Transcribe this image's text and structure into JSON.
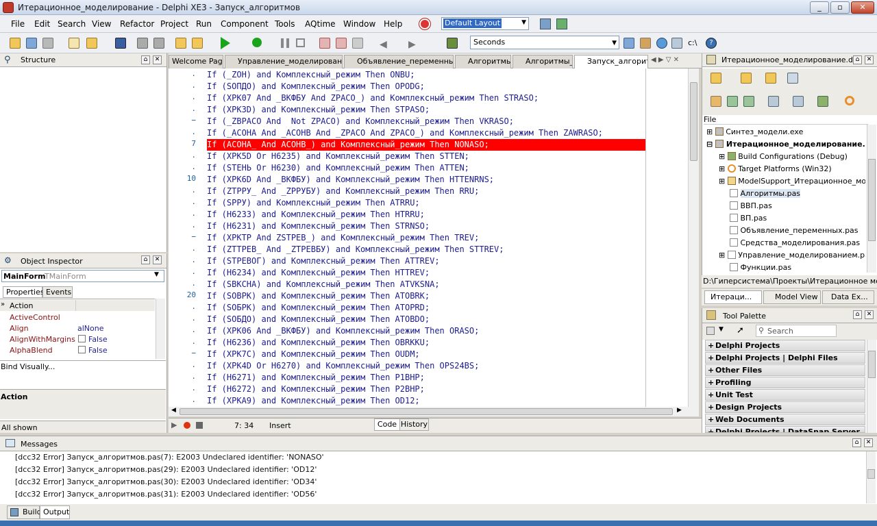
{
  "window": {
    "title": "Итерационное_моделирование - Delphi XE3 - Запуск_алгоритмов"
  },
  "menu": {
    "items": [
      "File",
      "Edit",
      "Search",
      "View",
      "Refactor",
      "Project",
      "Run",
      "Component",
      "Tools",
      "AQtime",
      "Window",
      "Help"
    ],
    "layout_value": "Default Layout"
  },
  "toolbar": {
    "time_unit": "Seconds"
  },
  "structure": {
    "title": "Structure"
  },
  "object_inspector": {
    "title": "Object Inspector",
    "component": "MainForm",
    "component_type": "TMainForm",
    "tabs": [
      "Properties",
      "Events"
    ],
    "properties": [
      {
        "name": "Action",
        "value": ""
      },
      {
        "name": "ActiveControl",
        "value": ""
      },
      {
        "name": "Align",
        "value": "alNone"
      },
      {
        "name": "AlignWithMargins",
        "value": "False"
      },
      {
        "name": "AlphaBlend",
        "value": "False"
      }
    ],
    "bind_visually": "Bind Visually...",
    "desc_title": "Action",
    "footer": "All shown"
  },
  "editor": {
    "tabs": [
      "Welcome Page",
      "Управление_моделирован",
      "Объявление_переменных",
      "Алгоритмы",
      "Алгоритмы_",
      "Запуск_алгоритм"
    ],
    "lines": [
      "If (_ZOH) and Комплексный_режим Then ONBU;",
      "If (SOПДО) and Комплексный_режим Then OPODG;",
      "If (XPK07 And _BKФБУ And ZPACO_) and Комплексный_режим Then STRASO;",
      "If (XPK3D) and Комплексный_режим Then STPASO;",
      "If (_ZBPACO And  Not ZPACO) and Комплексный_режим Then VKRASO;",
      "If (_ACOHA And _ACOHB And _ZPACO And ZPACO_) and Комплексный_режим Then ZAWRASO;",
      "If (ACOHA_ And ACOHB_) and Комплексный_режим Then NONASO;",
      "If (XPK5D Or H6235) and Комплексный_режим Then STTEN;",
      "If (STEHЬ Or H6230) and Комплексный_режим Then ATTEN;",
      "If (XPK6D And _BKФБУ) and Комплексный_режим Then HTTENRNS;",
      "If (ZTPPУ_ And _ZPPУБУ) and Комплексный_режим Then RRU;",
      "If (SPPУ) and Комплексный_режим Then ATRRU;",
      "If (H6233) and Комплексный_режим Then HTRRU;",
      "If (H6231) and Комплексный_режим Then STRNSO;",
      "If (XPKTP And ZSTPEB_) and Комплексный_режим Then TREV;",
      "If (ZTTPEB_ And _ZTPEBБУ) and Комплексный_режим Then STTREV;",
      "If (STPEBОГ) and Комплексный_режим Then ATTREV;",
      "If (H6234) and Комплексный_режим Then HTTREV;",
      "If (SBKCHA) and Комплексный_режим Then ATVKSNA;",
      "If (SOBPK) and Комплексный_режим Then ATOBRK;",
      "If (SOБPK) and Комплексный_режим Then ATOPRD;",
      "If (SOБДО) and Комплексный_режим Then ATOBDO;",
      "If (XPK06 And _BKФБУ) and Комплексный_режим Then ORASO;",
      "If (H6236) and Комплексный_режим Then OBRKKU;",
      "If (XPK7C) and Комплексный_режим Then OUDM;",
      "If (XPK4D Or H6270) and Комплексный_режим Then OPS24BS;",
      "If (H6271) and Комплексный_режим Then P1BHP;",
      "If (H6272) and Комплексный_режим Then P2BHP;",
      "If (XPKA9) and Комплексный_режим Then OD12;"
    ],
    "gutter": {
      "l0": ".",
      "l1": ".",
      "l2": ".",
      "l3": ".",
      "l4": "−",
      "l5": ".",
      "l6": "7",
      "l7": ".",
      "l8": ".",
      "l9": "10",
      "l10": ".",
      "l11": ".",
      "l12": ".",
      "l13": ".",
      "l14": "−",
      "l15": ".",
      "l16": ".",
      "l17": ".",
      "l18": ".",
      "l19": "20",
      "l20": ".",
      "l21": ".",
      "l22": ".",
      "l23": ".",
      "l24": "−",
      "l25": ".",
      "l26": ".",
      "l27": ".",
      "l28": "."
    },
    "error_line_index": 6,
    "status": {
      "position": "7: 34",
      "mode": "Insert",
      "tabs": [
        "Code",
        "History"
      ]
    }
  },
  "project": {
    "title": "Итерационное_моделирование.d...",
    "file_label": "File",
    "items": [
      "Синтез_модели.exe",
      "Итерационное_моделирование...",
      "Build Configurations (Debug)",
      "Target Platforms (Win32)",
      "ModelSupport_Итерационное_мо...",
      "Алгоритмы.pas",
      "ВВП.pas",
      "ВП.pas",
      "Объявление_переменных.pas",
      "Средства_моделирования.pas",
      "Управление_моделированием.pas",
      "Функции.pas"
    ],
    "path": "D:\\Гиперсистема\\Проекты\\Итерационное моделир",
    "view_tabs": [
      "Итераци...",
      "Model View",
      "Data Ex..."
    ]
  },
  "tool_palette": {
    "title": "Tool Palette",
    "search_placeholder": "Search",
    "categories": [
      "Delphi Projects",
      "Delphi Projects | Delphi Files",
      "Other Files",
      "Profiling",
      "Unit Test",
      "Design Projects",
      "Web Documents",
      "Delphi Projects | DataSnap Server"
    ]
  },
  "messages": {
    "title": "Messages",
    "lines": [
      "[dcc32 Error] Запуск_алгоритмов.pas(7): E2003 Undeclared identifier: 'NONASO'",
      "[dcc32 Error] Запуск_алгоритмов.pas(29): E2003 Undeclared identifier: 'OD12'",
      "[dcc32 Error] Запуск_алгоритмов.pas(30): E2003 Undeclared identifier: 'OD34'",
      "[dcc32 Error] Запуск_алгоритмов.pas(31): E2003 Undeclared identifier: 'OD56'"
    ],
    "tabs": [
      "Build",
      "Output"
    ]
  }
}
